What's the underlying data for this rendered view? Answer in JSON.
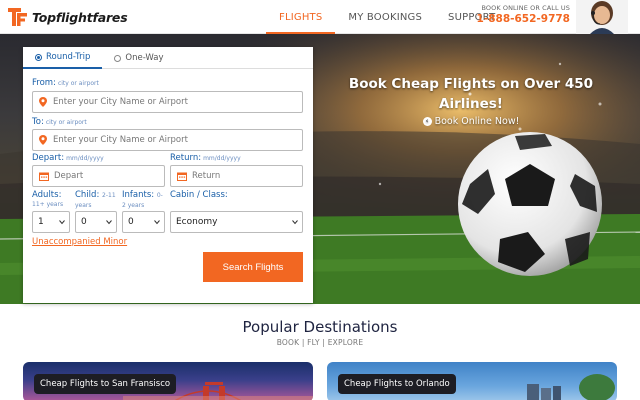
{
  "brand": {
    "name": "Topflightfares",
    "accent": "#f26722",
    "blue": "#1a5fa8"
  },
  "nav": {
    "items": [
      {
        "label": "FLIGHTS",
        "active": true
      },
      {
        "label": "MY BOOKINGS",
        "active": false
      },
      {
        "label": "SUPPORT",
        "active": false
      }
    ]
  },
  "call": {
    "label": "BOOK ONLINE OR CALL US",
    "phone": "1-888-652-9778"
  },
  "hero": {
    "title": "Book Cheap Flights on Over 450 Airlines!",
    "subtitle": "Book Online Now!"
  },
  "form": {
    "trip_types": [
      {
        "label": "Round-Trip",
        "selected": true
      },
      {
        "label": "One-Way",
        "selected": false
      }
    ],
    "from": {
      "label": "From:",
      "hint": "city or airport",
      "placeholder": "Enter your City Name or Airport"
    },
    "to": {
      "label": "To:",
      "hint": "city or airport",
      "placeholder": "Enter your City Name or Airport"
    },
    "depart": {
      "label": "Depart:",
      "hint": "mm/dd/yyyy",
      "placeholder": "Depart"
    },
    "return": {
      "label": "Return:",
      "hint": "mm/dd/yyyy",
      "placeholder": "Return"
    },
    "adults": {
      "label": "Adults:",
      "hint": "11+ years",
      "value": "1"
    },
    "child": {
      "label": "Child:",
      "hint_a": "2-11",
      "hint_b": "years",
      "value": "0"
    },
    "infants": {
      "label": "Infants:",
      "hint_a": "0-",
      "hint_b": "2 years",
      "value": "0"
    },
    "cabin": {
      "label": "Cabin / Class:",
      "value": "Economy"
    },
    "unaccompanied": "Unaccompanied Minor",
    "search": "Search Flights"
  },
  "popular": {
    "title": "Popular Destinations",
    "subtitle": "BOOK | FLY | EXPLORE",
    "cards": [
      {
        "label": "Cheap Flights to San Fransisco"
      },
      {
        "label": "Cheap Flights to Orlando"
      }
    ]
  }
}
